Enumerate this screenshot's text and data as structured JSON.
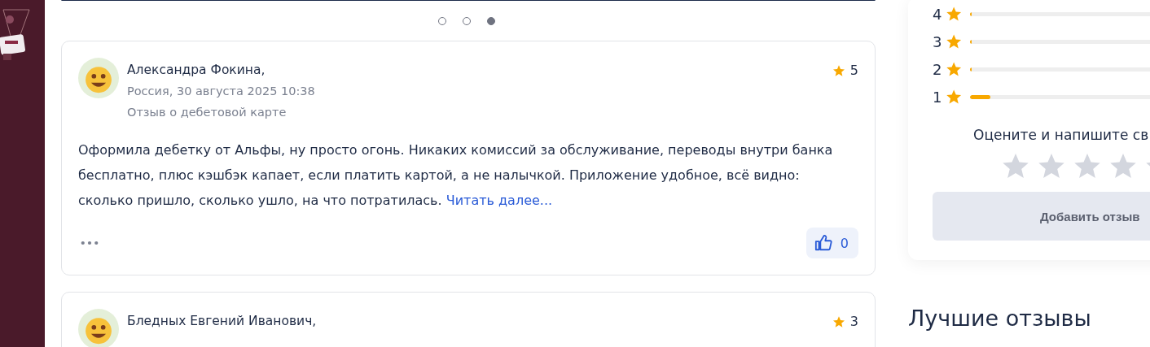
{
  "carousel": {
    "dots": [
      {
        "selected": false
      },
      {
        "selected": false
      },
      {
        "selected": true
      }
    ]
  },
  "reviews": [
    {
      "author": "Александра Фокина,",
      "meta": "Россия, 30 августа 2025 10:38",
      "subject": "Отзыв о дебетовой карте",
      "rating": "5",
      "text": "Оформила дебетку от Альфы, ну просто огонь. Никаких комиссий за обслуживание, переводы внутри банка бесплатно, плюс кэшбэк капает, если платить картой, а не налычкой. Приложение удобное, всё видно: сколько пришло, сколько ушло, на что потратилась.",
      "more_link": "Читать далее...",
      "likes": "0"
    },
    {
      "author": "Бледных Евгений Иванович,",
      "rating": "3"
    }
  ],
  "rating_summary": {
    "rows": [
      {
        "stars_label": "4",
        "level": 0.01
      },
      {
        "stars_label": "3",
        "level": 0.005
      },
      {
        "stars_label": "2",
        "level": 0.005
      },
      {
        "stars_label": "1",
        "level": 0.1
      }
    ],
    "prompt": "Оцените и напишите св",
    "add_button": "Добавить отзыв"
  },
  "best_reviews_heading": "Лучшие отзывы"
}
